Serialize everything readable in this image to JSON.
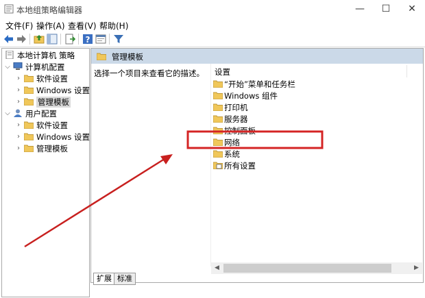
{
  "window": {
    "title": "本地组策略编辑器",
    "min_symbol": "—",
    "max_symbol": "☐",
    "close_symbol": "✕"
  },
  "menu": [
    "文件(F)",
    "操作(A)",
    "查看(V)",
    "帮助(H)"
  ],
  "toolbar": {
    "icons": [
      "back-arrow-icon",
      "forward-arrow-icon",
      "up-folder-icon",
      "show-hide-tree-icon",
      "export-list-icon",
      "help-icon",
      "properties-icon",
      "filter-icon"
    ]
  },
  "tree": {
    "root": "本地计算机 策略",
    "computer_config": "计算机配置",
    "computer_children": [
      "软件设置",
      "Windows 设置",
      "管理模板"
    ],
    "user_config": "用户配置",
    "user_children": [
      "软件设置",
      "Windows 设置",
      "管理模板"
    ]
  },
  "right": {
    "header": "管理模板",
    "description": "选择一个项目来查看它的描述。",
    "column_header": "设置",
    "items": [
      "“开始”菜单和任务栏",
      "Windows 组件",
      "打印机",
      "服务器",
      "控制面板",
      "网络",
      "系统",
      "所有设置"
    ]
  },
  "tabs": [
    "扩展",
    "标准"
  ],
  "colors": {
    "highlight_box": "#d42424",
    "arrow": "#c8201f",
    "header_bg": "#cbd9e8",
    "folder": "#f0c75a"
  }
}
